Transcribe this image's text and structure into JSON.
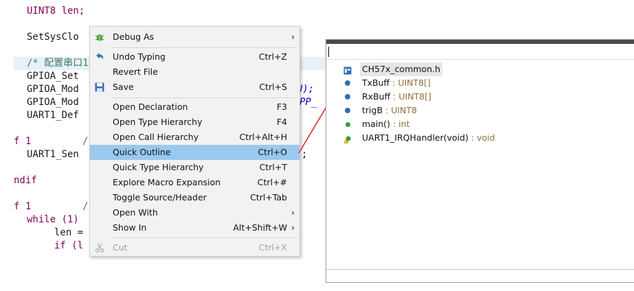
{
  "code": {
    "l1": "UINT8 len;",
    "l2": "SetSysClo",
    "l3": "/* 配置串口1",
    "l4": "GPIOA_Set",
    "l5a": "GPIOA_Mod",
    "l5b": "U);",
    "l6a": "GPIOA_Mod",
    "l6b": "PP_",
    "l7": "UART1_Def",
    "l8a": "f 1",
    "l8b": "/",
    "l9a": "UART1_Sen",
    "l9b": ";",
    "l10": "ndif",
    "l11a": "f 1",
    "l11b": "/",
    "l12": "while (1)",
    "l13": "len =",
    "l14": "if (l"
  },
  "context_menu": {
    "items": [
      {
        "label": "Debug As",
        "shortcut": "",
        "submenu": true,
        "icon": "debug-bug-icon"
      },
      {
        "label": "Undo Typing",
        "shortcut": "Ctrl+Z",
        "icon": "undo-icon"
      },
      {
        "label": "Revert File",
        "shortcut": ""
      },
      {
        "label": "Save",
        "shortcut": "Ctrl+S",
        "icon": "save-disk-icon"
      },
      {
        "label": "Open Declaration",
        "shortcut": "F3"
      },
      {
        "label": "Open Type Hierarchy",
        "shortcut": "F4"
      },
      {
        "label": "Open Call Hierarchy",
        "shortcut": "Ctrl+Alt+H"
      },
      {
        "label": "Quick Outline",
        "shortcut": "Ctrl+O",
        "selected": true
      },
      {
        "label": "Quick Type Hierarchy",
        "shortcut": "Ctrl+T"
      },
      {
        "label": "Explore Macro Expansion",
        "shortcut": "Ctrl+#"
      },
      {
        "label": "Toggle Source/Header",
        "shortcut": "Ctrl+Tab"
      },
      {
        "label": "Open With",
        "shortcut": "",
        "submenu": true
      },
      {
        "label": "Show In",
        "shortcut": "Alt+Shift+W",
        "submenu": true
      },
      {
        "label": "Cut",
        "shortcut": "Ctrl+X",
        "disabled": true,
        "icon": "scissors-icon"
      }
    ],
    "submenu_arrow": "›"
  },
  "quick_outline": {
    "filter_value": "",
    "items": [
      {
        "name": "CH57x_common.h",
        "type": "",
        "icon": "include-header-icon",
        "selected": true
      },
      {
        "name": "TxBuff",
        "type": " : UINT8[]",
        "icon": "variable-blue-dot-icon"
      },
      {
        "name": "RxBuff",
        "type": " : UINT8[]",
        "icon": "variable-blue-dot-icon"
      },
      {
        "name": "trigB",
        "type": " : UINT8",
        "icon": "variable-blue-dot-icon"
      },
      {
        "name": "main()",
        "type": " : int",
        "icon": "function-green-dot-icon"
      },
      {
        "name": "UART1_IRQHandler(void)",
        "type": " : void",
        "icon": "function-warning-icon"
      }
    ]
  },
  "colors": {
    "selection": "#99c9ef",
    "menu_bg": "#f2f2f2",
    "arrow": "#e8232a",
    "type_text": "#8f6f3a"
  }
}
